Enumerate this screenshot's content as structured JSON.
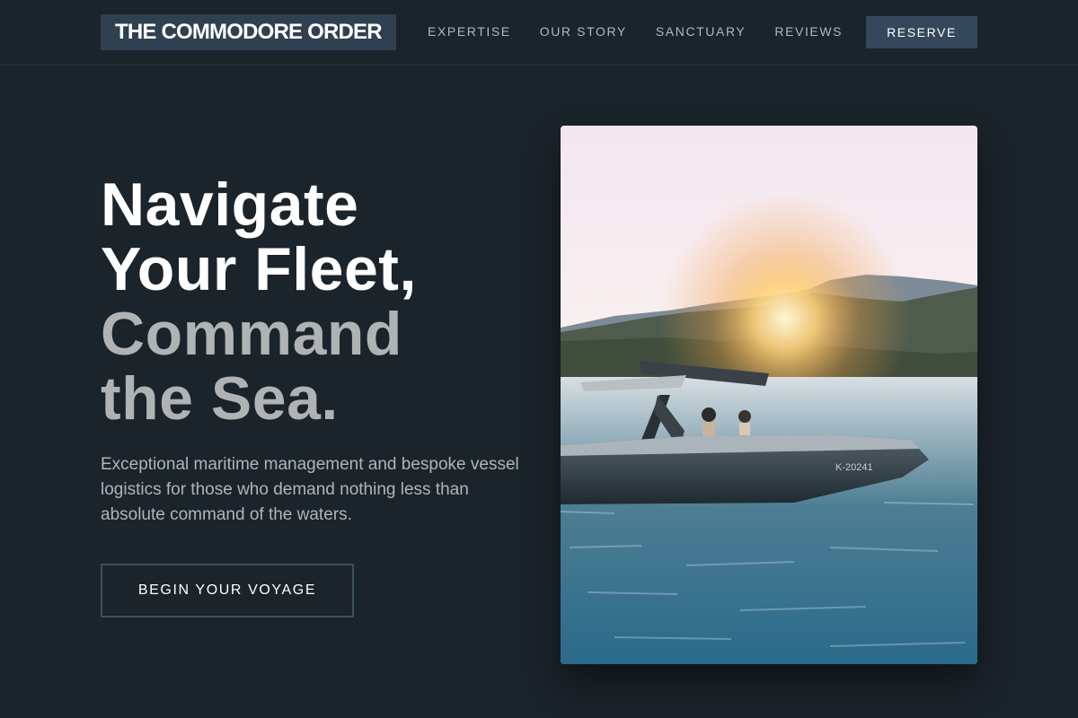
{
  "nav": {
    "logo": "THE COMMODORE ORDER",
    "links": [
      "EXPERTISE",
      "OUR STORY",
      "SANCTUARY",
      "REVIEWS"
    ],
    "reserve_label": "RESERVE"
  },
  "hero": {
    "title_lines": [
      "Navigate",
      "Your Fleet,",
      "Command",
      "the Sea."
    ],
    "description": "Exceptional maritime management and bespoke vessel logistics for those who demand nothing less than absolute command of the waters.",
    "cta_label": "BEGIN YOUR VOYAGE"
  },
  "photo": {
    "subject": "speedboat-at-sunset",
    "hull_text": "K-20241"
  },
  "colors": {
    "background": "#1b232b",
    "logo_bg": "#2f4050",
    "reserve_bg": "#34485a",
    "title_white": "#ffffff",
    "title_grey": "#b0b3b3",
    "body_text": "#aeb6bc"
  }
}
